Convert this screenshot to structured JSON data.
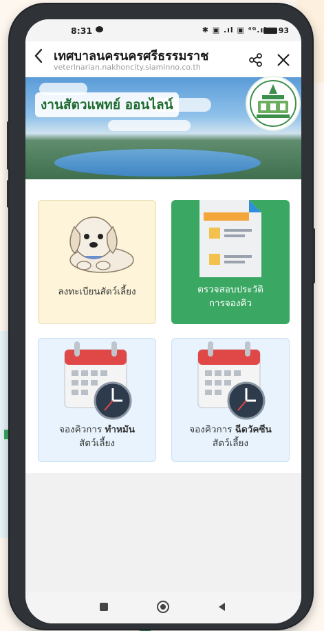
{
  "status_bar": {
    "time": "8:31",
    "signal_icons": "✱ ▣ .ıl ▣ ⁴ᴳ.ıl",
    "battery": "93"
  },
  "nav_bar": {
    "back_icon": "chevron-left-icon",
    "title": "เทศบาลนครนครศรีธรรมราช",
    "url": "veterinarian.nakhoncity.siaminno.co.th",
    "share_icon": "share-icon",
    "close_icon": "close-icon"
  },
  "banner": {
    "title": "งานสัตวแพทย์ ออนไลน์",
    "logo": "municipality-seal"
  },
  "menu": [
    {
      "id": "register",
      "label": "ลงทะเบียนสัตว์เลี้ยง",
      "icon": "puppy-icon"
    },
    {
      "id": "history",
      "label_line1": "ตรวจสอบประวัติ",
      "label_line2": "การจองคิว",
      "icon": "document-icon"
    },
    {
      "id": "sterilize",
      "label_prefix": "จองคิวการ ",
      "label_bold": "ทำหมัน",
      "label_line2": "สัตว์เลี้ยง",
      "icon": "calendar-clock-icon"
    },
    {
      "id": "vaccine",
      "label_prefix": "จองคิวการ ",
      "label_bold": "ฉีดวัคซีน",
      "label_line2": "สัตว์เลี้ยง",
      "icon": "calendar-clock-icon"
    }
  ],
  "colors": {
    "accent_green": "#3aa862",
    "card_yellow": "#fdf4d9",
    "card_blue": "#e8f3fd",
    "calendar_red": "#e04848"
  },
  "system_nav": {
    "recent": "square-icon",
    "home": "circle-icon",
    "back": "triangle-back-icon"
  }
}
